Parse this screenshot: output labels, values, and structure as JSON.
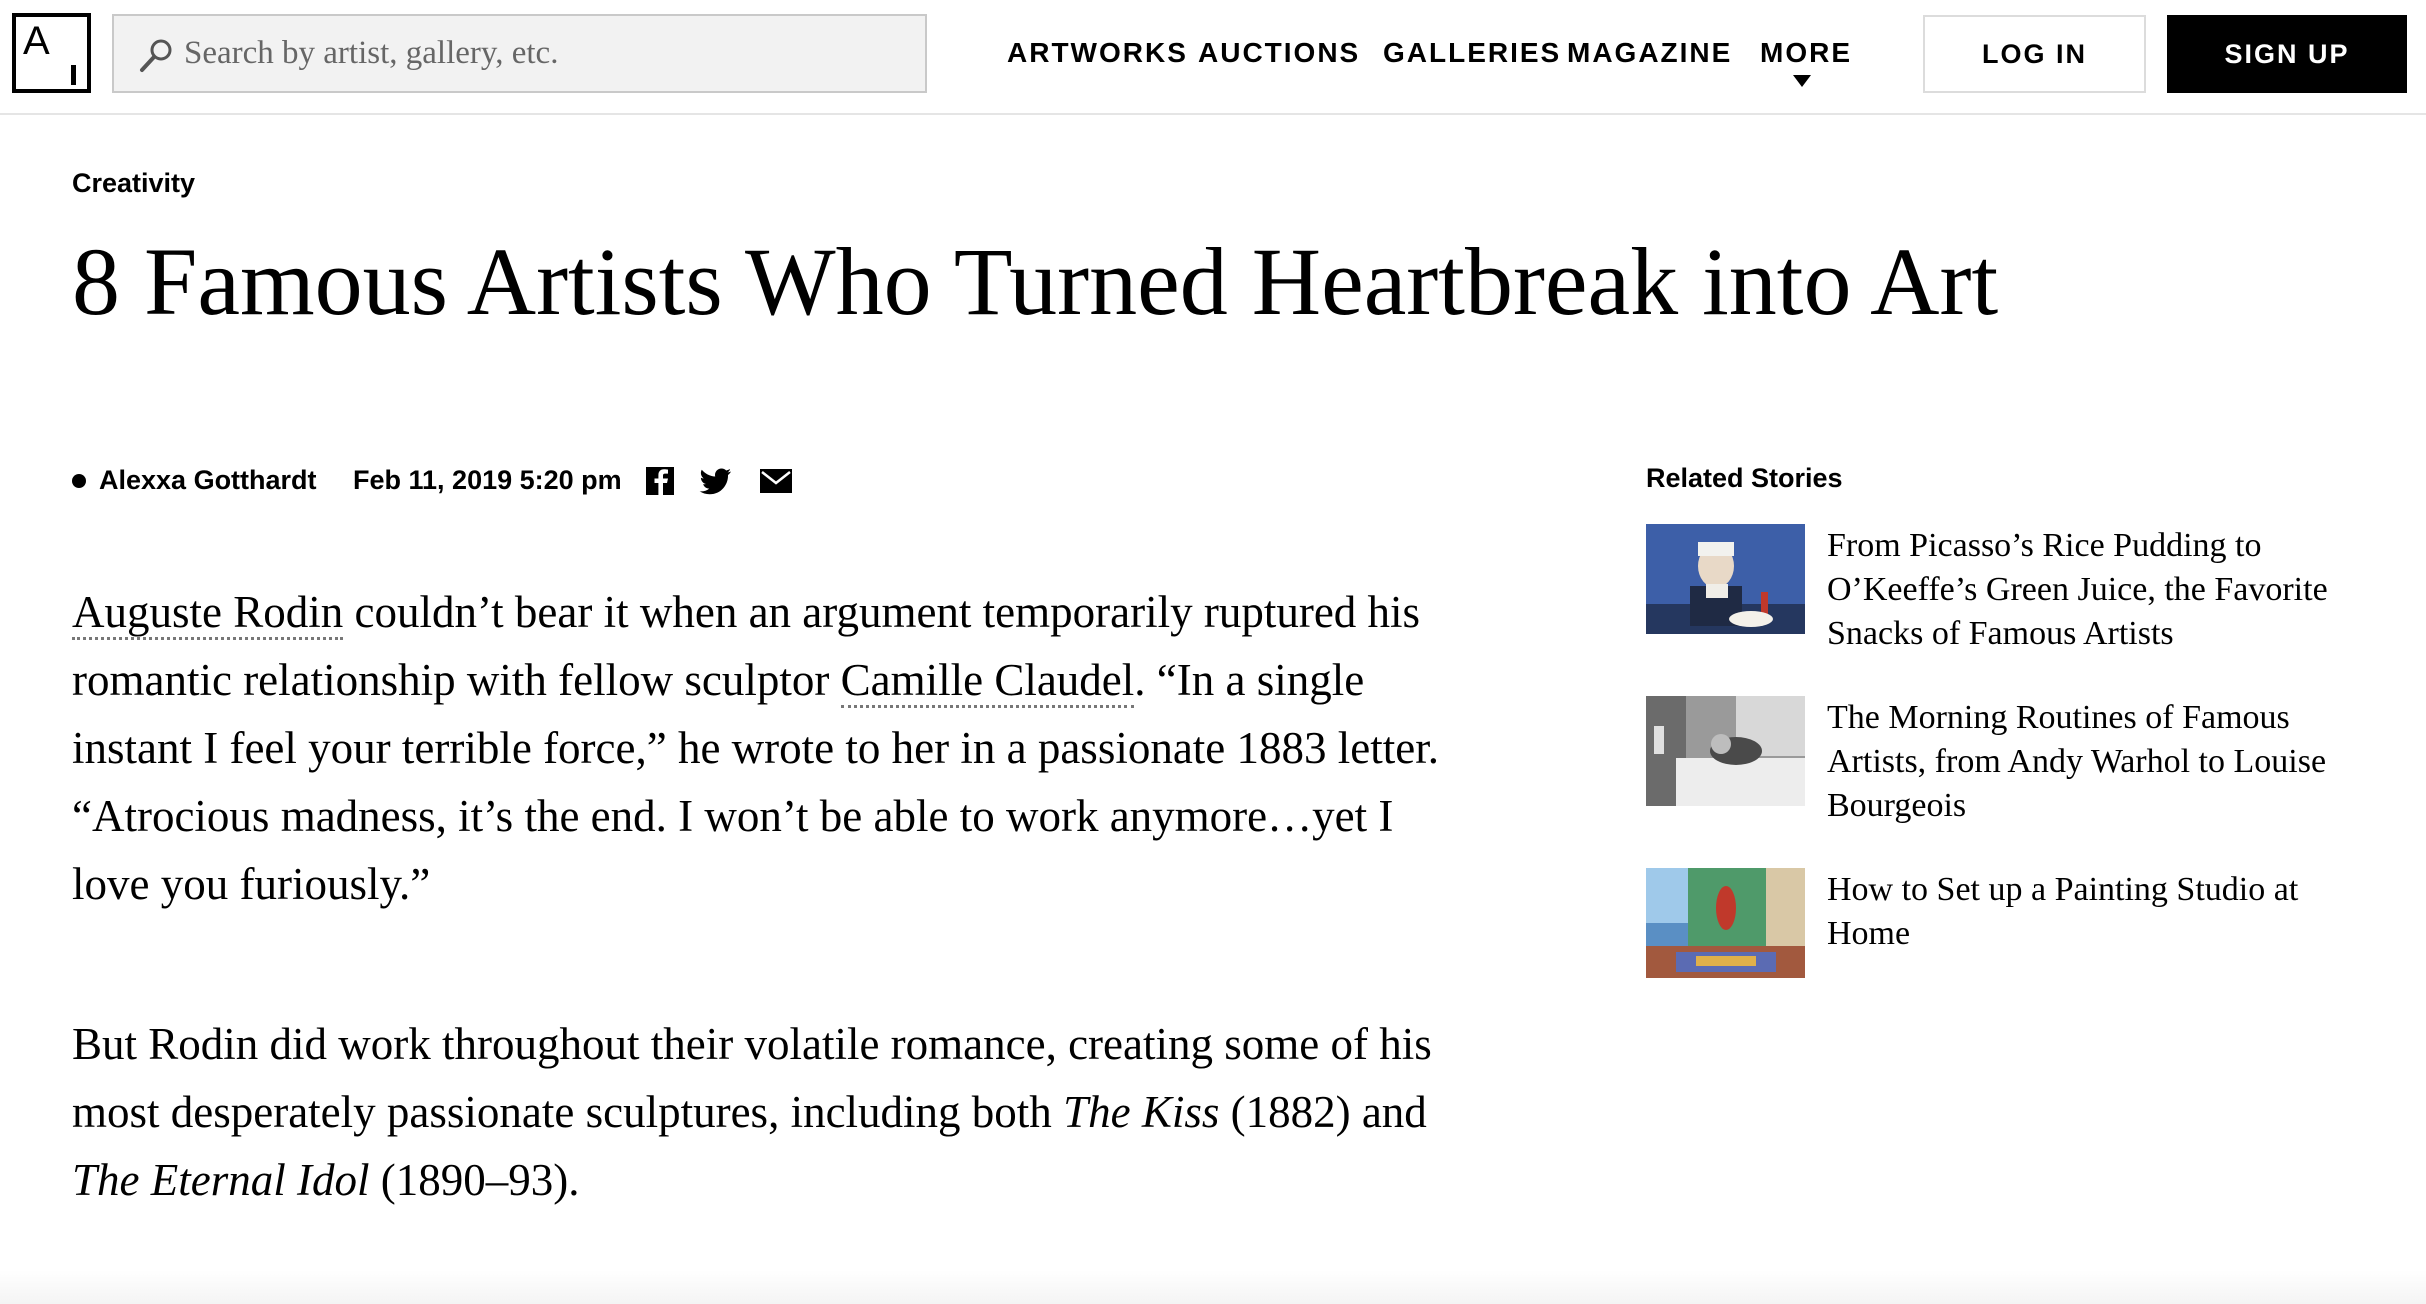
{
  "header": {
    "logo_text": "A",
    "search_placeholder": "Search by artist, gallery, etc.",
    "nav": [
      "ARTWORKS",
      "AUCTIONS",
      "GALLERIES",
      "MAGAZINE",
      "MORE"
    ],
    "login_label": "LOG IN",
    "signup_label": "SIGN UP"
  },
  "article": {
    "category": "Creativity",
    "title": "8 Famous Artists Who Turned Heartbreak into Art",
    "author": "Alexxa Gotthardt",
    "date": "Feb 11, 2019 5:20 pm",
    "share_icons": [
      "facebook-icon",
      "twitter-icon",
      "email-icon"
    ],
    "p1": {
      "link1": "Auguste Rodin",
      "text1": " couldn’t bear it when an argument temporarily ruptured his romantic relationship with fellow sculptor ",
      "link2": "Camille Claudel",
      "text2": ". “In a single instant I feel your terrible force,” he wrote to her in a passionate 1883 letter. “Atrocious madness, it’s the end. I won’t be able to work anymore…yet I love you furiously.”"
    },
    "p2": {
      "text1": "But Rodin did work throughout their volatile romance, creating some of his most desperately passionate sculptures, including both ",
      "italic1": "The Kiss",
      "text2": " (1882) and ",
      "italic2": "The Eternal Idol",
      "text3": " (1890–93)."
    }
  },
  "sidebar": {
    "title": "Related Stories",
    "stories": [
      {
        "title": "From Picasso’s Rice Pudding to O’Keeffe’s Green Juice, the Favorite Snacks of Famous Artists"
      },
      {
        "title": "The Morning Routines of Famous Artists, from Andy Warhol to Louise Bourgeois"
      },
      {
        "title": "How to Set up a Painting Studio at Home"
      }
    ]
  },
  "colors": {
    "text": "#000000",
    "search_bg": "#f2f2f2",
    "signup_bg": "#000000",
    "link_underline": "#777777"
  }
}
